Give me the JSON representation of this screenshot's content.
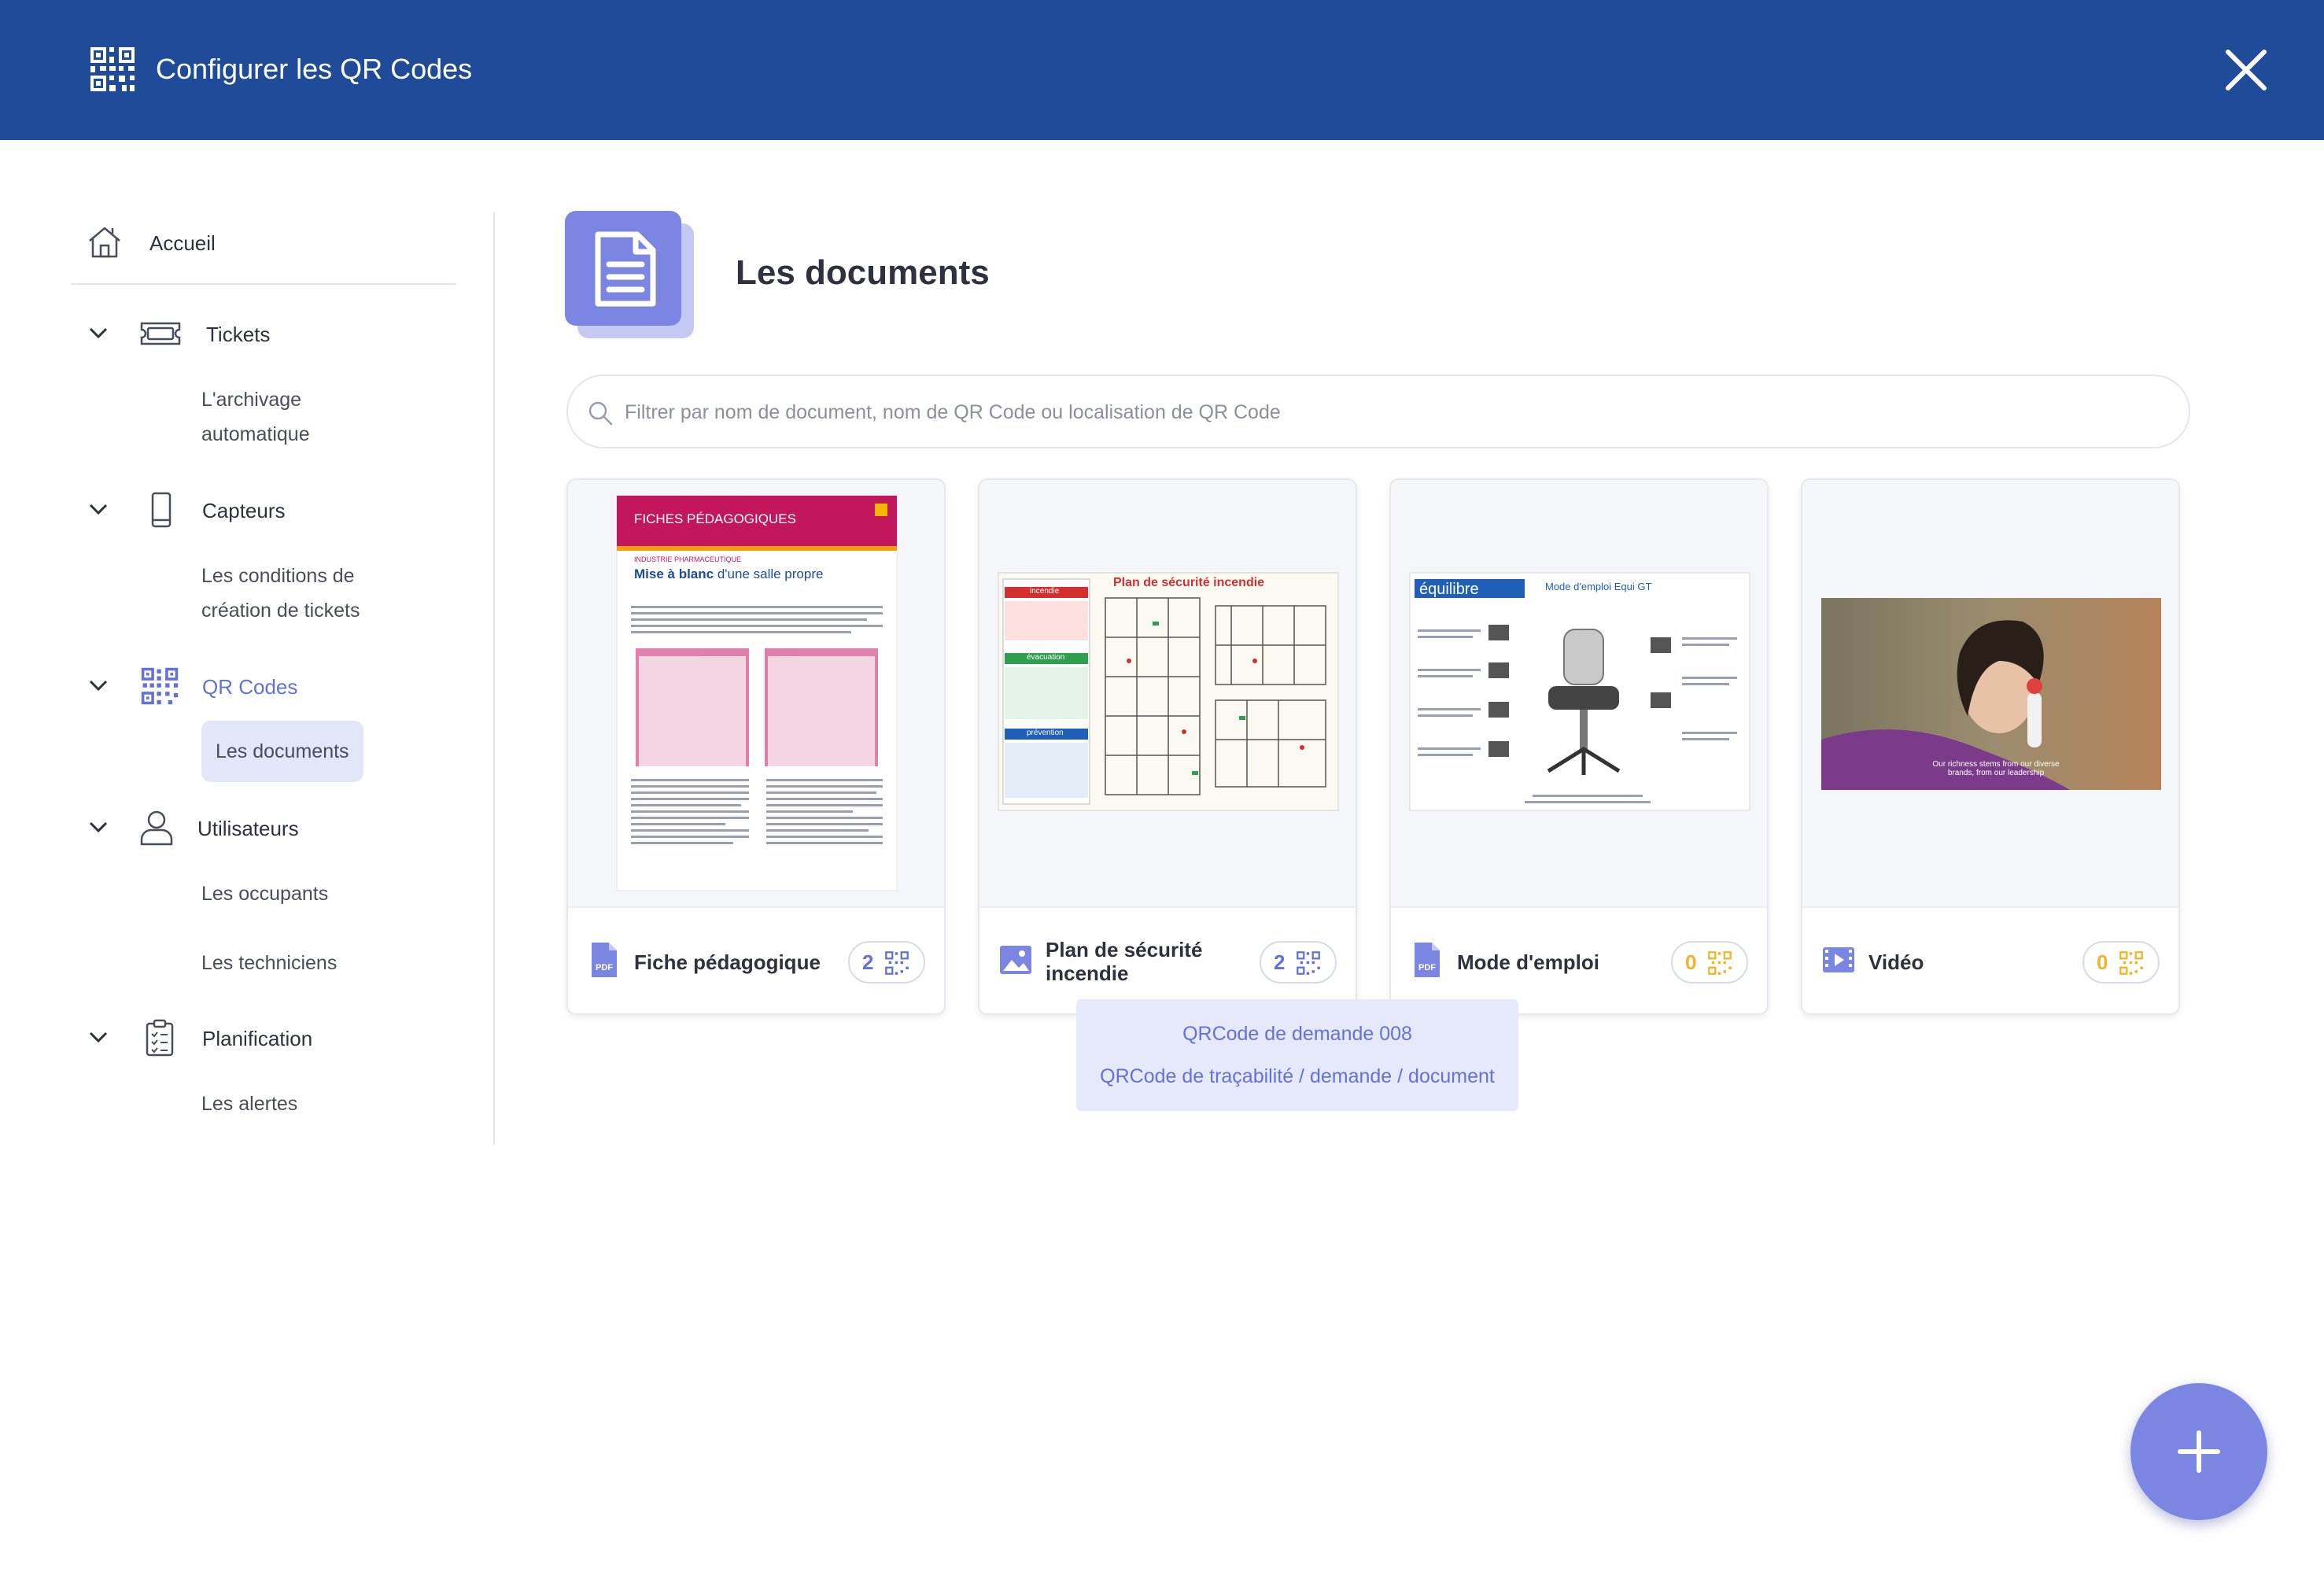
{
  "header": {
    "title": "Configurer les QR Codes",
    "close_icon": "close-icon"
  },
  "sidebar": {
    "home": {
      "label": "Accueil",
      "icon": "home-icon"
    },
    "sections": [
      {
        "label": "Tickets",
        "icon": "ticket-icon",
        "items": [
          "L'archivage automatique"
        ]
      },
      {
        "label": "Capteurs",
        "icon": "phone-icon",
        "items": [
          "Les conditions de création de tickets"
        ]
      },
      {
        "label": "QR Codes",
        "icon": "qr-code-icon",
        "active": true,
        "items": [
          "Les documents"
        ]
      },
      {
        "label": "Utilisateurs",
        "icon": "user-icon",
        "items": [
          "Les occupants",
          "Les techniciens"
        ]
      },
      {
        "label": "Planification",
        "icon": "clipboard-icon",
        "items": [
          "Les alertes"
        ]
      }
    ],
    "archivage_line1": "L'archivage",
    "archivage_line2": "automatique",
    "conditions_line1": "Les conditions de",
    "conditions_line2": "création de tickets"
  },
  "main": {
    "title": "Les documents",
    "search_placeholder": "Filtrer par nom de document, nom de QR Code ou localisation de QR Code",
    "cards": [
      {
        "name": "Fiche pédagogique",
        "type_icon": "pdf-icon",
        "count": "2",
        "count_color": "#6272d8",
        "thumb": {
          "header": "FICHES PÉDAGOGIQUES",
          "kicker": "INDUSTRIE PHARMACEUTIQUE",
          "heading_bold": "Mise à blanc",
          "heading_rest": " d'une salle propre"
        }
      },
      {
        "name_line1": "Plan de sécurité",
        "name_line2": "incendie",
        "type_icon": "image-icon",
        "count": "2",
        "count_color": "#6272d8",
        "thumb": {
          "heading": "Plan de sécurité incendie",
          "tag1": "incendie",
          "tag2": "évacuation",
          "tag3": "prévention"
        }
      },
      {
        "name": "Mode d'emploi",
        "type_icon": "pdf-icon",
        "count": "0",
        "count_color": "#f0b429",
        "thumb": {
          "brand": "équilibre",
          "heading": "Mode d'emploi Equi GT"
        }
      },
      {
        "name": "Vidéo",
        "type_icon": "video-icon",
        "count": "0",
        "count_color": "#f0b429",
        "thumb": {
          "caption_line1": "Our richness stems from our diverse",
          "caption_line2": "brands, from our leadership"
        }
      }
    ],
    "tooltip": [
      "QRCode de demande 008",
      "QRCode de traçabilité / demande / document"
    ]
  },
  "fab": {
    "icon": "plus-icon"
  },
  "colors": {
    "header": "#1f4b99",
    "accent": "#6272d8",
    "fab": "#7b86e2",
    "warning": "#f0b429"
  }
}
